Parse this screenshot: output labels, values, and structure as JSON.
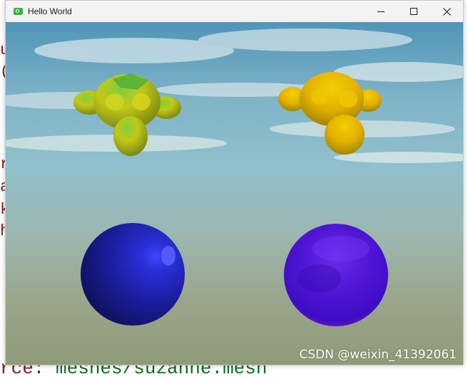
{
  "window": {
    "title": "Hello World",
    "icon": "qt-app-icon",
    "controls": [
      "minimize-icon",
      "maximize-icon",
      "close-icon"
    ]
  },
  "scene": {
    "objects": [
      {
        "name": "monkey-left",
        "color": "#b7c21a"
      },
      {
        "name": "monkey-right",
        "color": "#e0b400"
      },
      {
        "name": "sphere-left",
        "color": "#1c1c9e"
      },
      {
        "name": "sphere-right",
        "color": "#5a16d8"
      }
    ],
    "sky": {
      "top": "#5d9fbf",
      "bottom": "#8f9a78"
    }
  },
  "background_editor": {
    "side_chars": [
      "u",
      "(",
      "",
      "r",
      "a",
      "k",
      "h"
    ],
    "bottom_prefix": "rce:",
    "bottom_string": "\"meshes/suzanne.mesh\""
  },
  "watermark": "CSDN @weixin_41392061"
}
